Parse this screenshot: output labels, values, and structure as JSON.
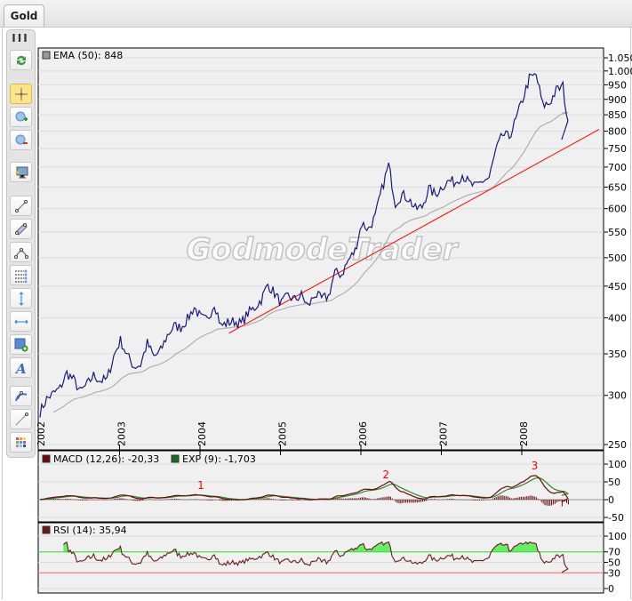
{
  "tab": {
    "label": "Gold"
  },
  "toolbar": {
    "grip": "III",
    "buttons": [
      {
        "icon": "refresh-icon"
      },
      {
        "icon": "crosshair-icon",
        "active": true
      },
      {
        "icon": "zoom-in-icon"
      },
      {
        "icon": "zoom-out-icon"
      },
      {
        "icon": "screenshot-icon"
      },
      {
        "icon": "line-tool-icon"
      },
      {
        "icon": "channel-tool-icon"
      },
      {
        "icon": "arc-tool-icon"
      },
      {
        "icon": "fibonacci-tool-icon"
      },
      {
        "icon": "vertical-line-icon"
      },
      {
        "icon": "horizontal-line-icon"
      },
      {
        "icon": "rectangle-tool-icon"
      },
      {
        "icon": "text-tool-icon"
      },
      {
        "icon": "curve-tool-icon"
      },
      {
        "icon": "ray-tool-icon"
      },
      {
        "icon": "color-palette-icon"
      }
    ]
  },
  "watermark": "GodmodeTrader",
  "colors": {
    "price": "#1a1a7a",
    "ema": "#b0b0b0",
    "trend": "#ff0000",
    "macd": "#6b0a0a",
    "signal": "#2a8a2a",
    "rsi": "#6b1a1a",
    "rsi_upper": "#33dd33",
    "rsi_lower": "#ff6666",
    "panel_bg": "#f0f0f0"
  },
  "chart_data": [
    {
      "type": "line",
      "title": "Gold",
      "scale": "log",
      "ylim": [
        250,
        1050
      ],
      "yticks": [
        "1.050",
        "1.000",
        "950",
        "900",
        "850",
        "800",
        "750",
        "700",
        "650",
        "600",
        "550",
        "500",
        "450",
        "400",
        "350",
        "300",
        "250"
      ],
      "ytick_values": [
        1050,
        1000,
        950,
        900,
        850,
        800,
        750,
        700,
        650,
        600,
        550,
        500,
        450,
        400,
        350,
        300,
        250
      ],
      "xticks": [
        "2002",
        "2003",
        "2004",
        "2005",
        "2006",
        "2007",
        "2008"
      ],
      "x_start": "2002-01",
      "series": [
        {
          "name": "Gold",
          "frequency": "monthly",
          "values": [
            282,
            296,
            302,
            308,
            326,
            318,
            304,
            312,
            323,
            317,
            318,
            347,
            368,
            348,
            334,
            336,
            364,
            346,
            354,
            375,
            388,
            386,
            398,
            416,
            400,
            396,
            423,
            388,
            393,
            395,
            391,
            407,
            415,
            428,
            453,
            438,
            422,
            434,
            428,
            435,
            417,
            437,
            429,
            433,
            473,
            470,
            495,
            513,
            568,
            556,
            582,
            644,
            705,
            613,
            632,
            623,
            599,
            604,
            646,
            632,
            652,
            665,
            662,
            681,
            659,
            650,
            665,
            672,
            743,
            789,
            783,
            834,
            900,
            972,
            985,
            880,
            887,
            930,
            945,
            775
          ]
        }
      ],
      "indicator": {
        "label": "EMA (50): 848",
        "name": "EMA",
        "period": 50
      },
      "trendline": {
        "start": [
          2004.35,
          378
        ],
        "end": [
          2008.95,
          805
        ]
      },
      "grid": true
    },
    {
      "type": "line",
      "title": "MACD",
      "legend": [
        {
          "label": "MACD (12,26): -20,33"
        },
        {
          "label": "EXP (9): -1,703"
        }
      ],
      "ylim": [
        -60,
        120
      ],
      "yticks": [
        "100",
        "50",
        "0",
        "-50"
      ],
      "ytick_values": [
        100,
        50,
        0,
        -50
      ],
      "annotations": [
        {
          "text": "1",
          "x": 2004.0,
          "y": 30
        },
        {
          "text": "2",
          "x": 2006.3,
          "y": 60
        },
        {
          "text": "3",
          "x": 2008.15,
          "y": 85
        }
      ]
    },
    {
      "type": "line",
      "title": "RSI",
      "legend": [
        {
          "label": "RSI (14): 35,94"
        }
      ],
      "ylim": [
        -5,
        110
      ],
      "yticks": [
        "100",
        "70",
        "50",
        "30",
        "0"
      ],
      "ytick_values": [
        100,
        70,
        50,
        30,
        0
      ],
      "levels": [
        70,
        30
      ]
    }
  ]
}
